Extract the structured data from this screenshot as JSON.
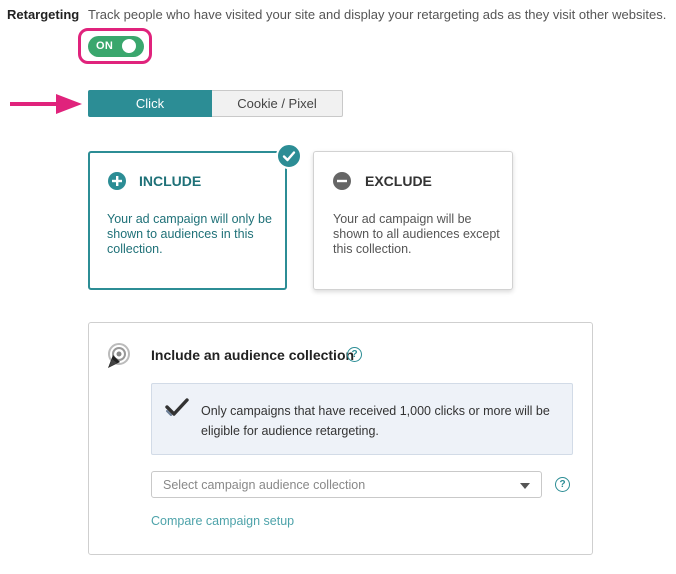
{
  "retargeting": {
    "label": "Retargeting",
    "description": "Track people who have visited your site and display your retargeting ads as they visit other websites.",
    "toggle_label": "ON",
    "toggle_on": true
  },
  "mode_tabs": {
    "click_label": "Click",
    "cookie_label": "Cookie / Pixel",
    "selected": "Click"
  },
  "audience_mode": {
    "include": {
      "icon": "plus-circle-icon",
      "title": "INCLUDE",
      "description": "Your ad campaign will only be shown to audiences in this collection.",
      "selected": true
    },
    "exclude": {
      "icon": "minus-circle-icon",
      "title": "EXCLUDE",
      "description": "Your ad campaign will be shown to all audiences except this collection.",
      "selected": false
    }
  },
  "collection_panel": {
    "icon": "target-cursor-icon",
    "title": "Include an audience collection",
    "info_text": "Only campaigns that have received 1,000 clicks or more will be eligible for audience retargeting.",
    "select_placeholder": "Select campaign audience collection",
    "compare_link": "Compare campaign setup"
  },
  "colors": {
    "accent": "#2c8d95",
    "toggle_green": "#3aa76d",
    "highlight_pink": "#e0237c"
  }
}
